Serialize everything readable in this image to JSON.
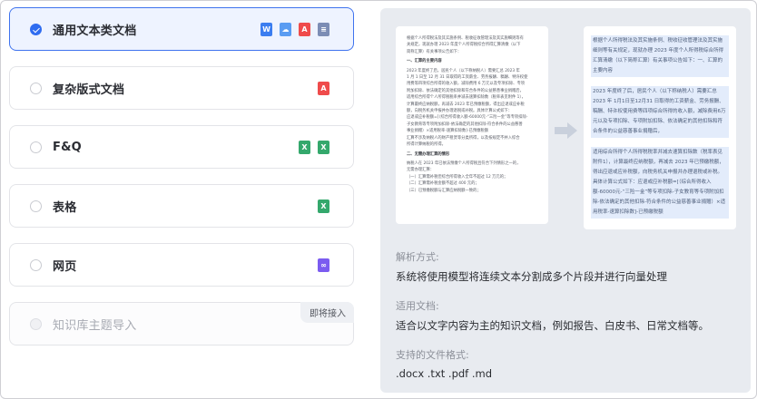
{
  "options": [
    {
      "label": "通用文本类文档",
      "selected": true,
      "icons": [
        {
          "name": "word-icon",
          "glyph": "W",
          "cls": "word"
        },
        {
          "name": "cloud-doc-icon",
          "glyph": "☁",
          "cls": "cloud"
        },
        {
          "name": "pdf-icon",
          "glyph": "A",
          "cls": "pdf"
        },
        {
          "name": "txt-icon",
          "glyph": "≡",
          "cls": "txt"
        }
      ]
    },
    {
      "label": "复杂版式文档",
      "selected": false,
      "icons": [
        {
          "name": "pdf-icon",
          "glyph": "A",
          "cls": "pdf"
        }
      ]
    },
    {
      "label": "F&Q",
      "selected": false,
      "icons": [
        {
          "name": "excel-q-icon",
          "glyph": "X",
          "cls": "excel"
        },
        {
          "name": "excel-icon",
          "glyph": "X",
          "cls": "excel"
        }
      ]
    },
    {
      "label": "表格",
      "selected": false,
      "icons": [
        {
          "name": "excel-icon",
          "glyph": "X",
          "cls": "excel"
        }
      ]
    },
    {
      "label": "网页",
      "selected": false,
      "icons": [
        {
          "name": "link-icon",
          "glyph": "∞",
          "cls": "link"
        }
      ]
    },
    {
      "label": "知识库主题导入",
      "selected": false,
      "disabled": true,
      "badge": "即将接入",
      "icons": []
    }
  ],
  "preview": {
    "doc_lines": [
      "根据个人所得税法及其实施条例、税收征收管理法及其实施细则等有",
      "关规定，现就办理 2023 年度个人所得税综合所得汇算清缴（以下",
      "简称汇算）有关事项公告如下：",
      "一、汇算的主要内容",
      "2023 年度终了后，居民个人（以下称纳税人）需要汇总 2023 年",
      "1 月 1 日至 12 月 31 日取得的工资薪金、劳务报酬、稿酬、特许权使",
      "用费等四项综合所得的收入额，减除费用 6 万元以及专项扣除、专项",
      "附加扣除、依法确定的其他扣除和符合条件的公益慈善事业捐赠后，",
      "适用综合所得个人所得税税率并减去速算扣除数（税率表见附件 1），",
      "计算最终应纳税额，再减去 2023 年已预缴税额，得出应退或应补税",
      "额，向税务机关申报并办理退税或补税。具体计算公式如下：",
      "应退或应补税额=[（综合所得收入额-60000元-“三险一金”等专项扣除-",
      "子女教育等专项附加扣除-依法确定的其他扣除-符合条件的公益慈善",
      "事业捐赠）×适用税率-速算扣除数]-已预缴税额",
      "汇算不涉及纳税人的财产租赁等分类所得，以及按规定不并入综合",
      "所得计算纳税的所得。",
      "二、无需办理汇算的情形",
      "纳税人在 2023 年已依法预缴个人所得税且符合下列情形之一的，",
      "无需办理汇算：",
      "（一）汇算需补税但综合所得收入全年不超过 12 万元的；",
      "（二）汇算需补税金额不超过 400 元的；",
      "（三）已预缴税额与汇算应纳税额一致的；"
    ],
    "chunks": [
      "根据个人所得税法及其实施条例、税收征收管理法及其实施细则等有关规定，现就办理 2023 年度个人所得税综合所得汇算清缴（以下简称汇算）有关事项公告如下：一、汇算的主要内容",
      "2023 年度终了后，居民个人（以下称纳税人）需要汇总 2023 年 1月1日至12月31 日取得的工资薪金、劳务报酬、稿酬、特许权使用费等四项综合所得的收入额，减除费用6万元以及专项扣除、专项附加扣除、依法确定的其他扣除和符合条件的公益慈善事业捐赠后，",
      "适用综合所得个人所得税税率并减去速算扣除数（税率表见附件1），计算最终应纳税额，再减去 2023 年已预缴税额，得出应退或应补税额，向税务机关申报并办理退税或补税。具体计算公式如下：应退或应补税额=[（综合所得收入额-60000元-“三险一金”等专项扣除-子女教育等专项附加扣除-依法确定的其他扣除-符合条件的公益慈善事业捐赠）×适用税率-速算扣除数]-已预缴税额"
    ]
  },
  "description": {
    "parse_title": "解析方式:",
    "parse_text": "系统将使用模型将连续文本分割成多个片段并进行向量处理",
    "applicable_title": "适用文档:",
    "applicable_text": "适合以文字内容为主的知识文档，例如报告、白皮书、日常文档等。",
    "formats_title": "支持的文件格式:",
    "formats_text": ".docx .txt .pdf .md"
  }
}
